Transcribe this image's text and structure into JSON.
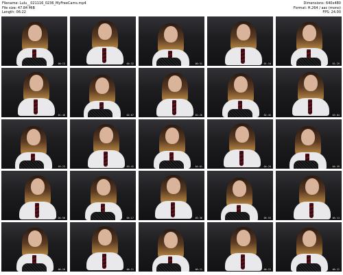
{
  "header": {
    "left": [
      "Filename: Lulu__021116_0236_MyFreeCams.mp4",
      "File size: 47.84 MiB",
      "Length: 06:22"
    ],
    "right": [
      "Dimensions: 640x480",
      "Format: H.264 / aac (mono)",
      "FPS: 24.00"
    ]
  },
  "thumbnails": [
    {
      "time": "00:13"
    },
    {
      "time": "00:32"
    },
    {
      "time": "00:51"
    },
    {
      "time": "01:10"
    },
    {
      "time": "01:29"
    },
    {
      "time": "01:48"
    },
    {
      "time": "02:07"
    },
    {
      "time": "02:26"
    },
    {
      "time": "02:45"
    },
    {
      "time": "03:04"
    },
    {
      "time": "03:23"
    },
    {
      "time": "03:42"
    },
    {
      "time": "04:01"
    },
    {
      "time": "04:20"
    },
    {
      "time": "04:39"
    },
    {
      "time": "04:58"
    },
    {
      "time": "05:17"
    },
    {
      "time": "05:36"
    },
    {
      "time": "05:55"
    },
    {
      "time": "06:14"
    },
    {
      "time": "06:20"
    },
    {
      "time": "06:21"
    },
    {
      "time": "06:21"
    },
    {
      "time": "06:22"
    },
    {
      "time": "06:22"
    }
  ]
}
